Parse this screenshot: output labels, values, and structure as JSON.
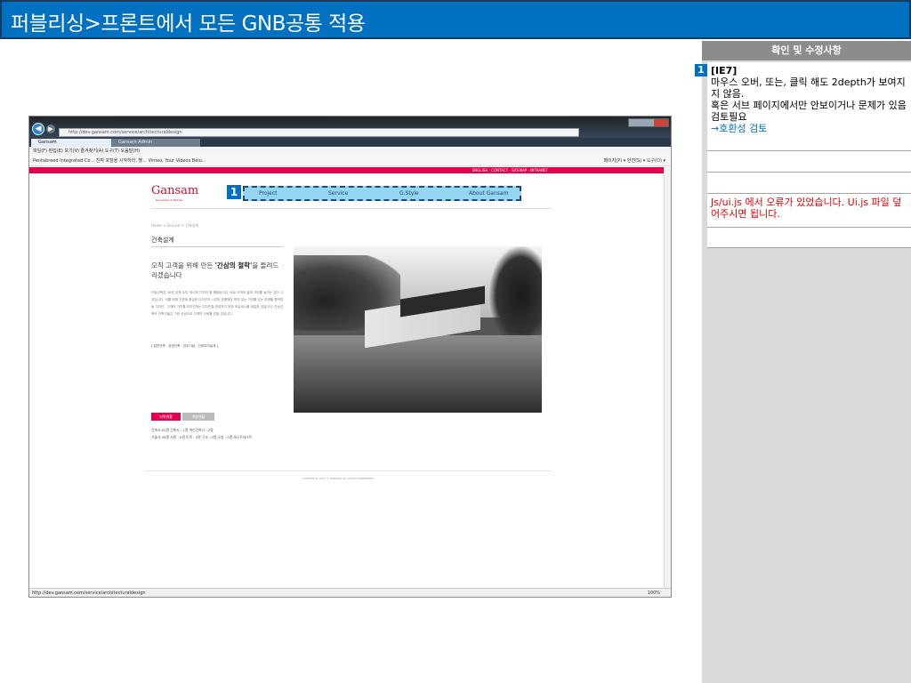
{
  "slide": {
    "title": "퍼블리싱>프론트에서 모든 GNB공통 적용"
  },
  "side_panel": {
    "header": "확인 및 수정사항",
    "badge": "1",
    "note1": {
      "tag": "[IE7]",
      "line1": "마우스 오버, 또는,  클릭 해도 2depth가 보여지지 않음.",
      "line2": "혹은 서브 페이지에서만 안보이거나 문제가 있음 검토필요",
      "link": "→호환성 검토"
    },
    "note4": "Js/ui.js 에서 오류가 있었습니다. Ui.js 파일 덮어주시면 됩니다."
  },
  "browser": {
    "address": "http://dev.gansam.com/service/architecturaldesign",
    "tab1": "Gansam",
    "tab2": "Gansam Admin",
    "menu": "파일(F)  편집(E)  보기(V)  즐겨찾기(A)  도구(T)  도움말(H)",
    "favorites": "Pentabreed Integrated Co...   진짜 포털을 시작하라. 헬...   Vimeo, Your Videos Belo...",
    "toolbar_right": "페이지(P) ▾  안전(S) ▾  도구(O) ▾",
    "status_url": "http://dev.gansam.com/service/architecturaldesign",
    "zoom": "100%"
  },
  "site": {
    "top_links": "ENGLISH · CONTACT · SITEMAP · INTRANET",
    "logo": "Gansam",
    "logo_sub": "Developer & Partner",
    "gnb_badge": "1",
    "nav": [
      "Project",
      "Service",
      "G.Style",
      "About Gansam"
    ],
    "breadcrumb": "Home > Service > 건축설계",
    "page_title": "건축설계",
    "headline_1": "오직 고객을 위해 만든 ",
    "headline_bold": "'간삼의 철학'",
    "headline_2": "을 들려드리겠습니다",
    "body": "간삼건축은 30년 넘게 오직 '하나의 디자인'을 해왔습니다. 바로 고객의 삶과 가치를 높이는 것이 그것입니다. 이를 위해 기본에 충실한 디자인과 시간이 흐름에도 변치 않는 가치를 담는 미래를 향하여 동 디자인', 고객의 가치를 최우선하는 디자인을 완성하기 위한 프로세스를 정립한 것입니다. 간삼건축의 건축가들은 그런 신념으로 고객의 신뢰를 받을 것입니다.",
    "tags": "[ 일반건축 · 공공건축 · 업무시설 · 인테리어설계 ]",
    "btn_primary": "지역현황",
    "btn_secondary": "개발현황",
    "stats_1": "건축사:50명  건축사 : 1명  개인건축사 : 2명",
    "stats_2": "기술사:38명  사용 : 0명  토목 : 0명  구조 : 0명  소방 : 0명  테스트테스트",
    "copyright": "COPYRIGHT 2012 © GANSAM ALL RIGHTS RESERVED."
  }
}
